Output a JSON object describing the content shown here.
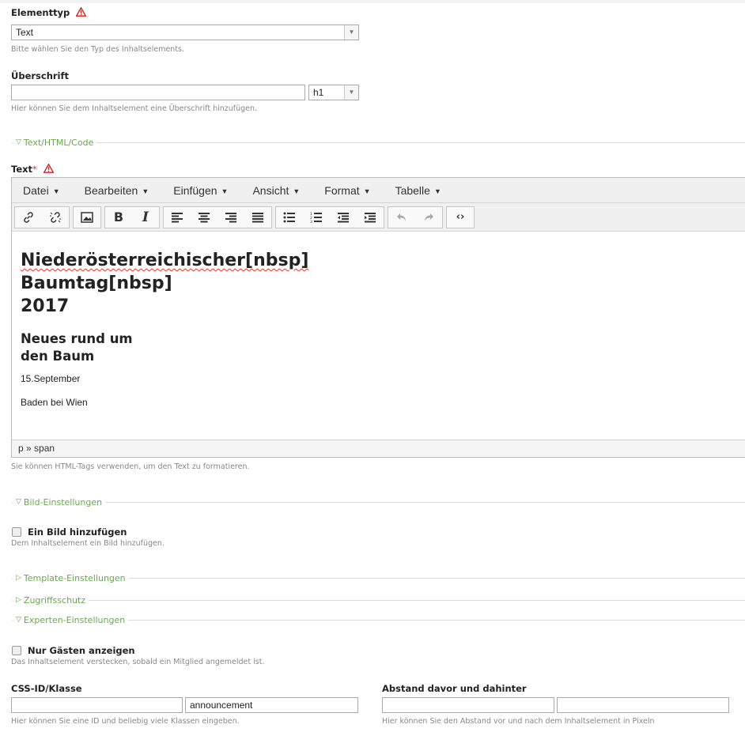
{
  "element_type": {
    "label": "Elementtyp",
    "value": "Text",
    "help": "Bitte wählen Sie den Typ des Inhaltselements."
  },
  "headline": {
    "label": "Überschrift",
    "value": "",
    "level": "h1",
    "help": "Hier können Sie dem Inhaltselement eine Überschrift hinzufügen."
  },
  "sections": {
    "text_html": "Text/HTML/Code",
    "image": "Bild-Einstellungen",
    "template": "Template-Einstellungen",
    "access": "Zugriffsschutz",
    "expert": "Experten-Einstellungen"
  },
  "text_field": {
    "label": "Text",
    "required_mark": "*",
    "help": "Sie können HTML-Tags verwenden, um den Text zu formatieren."
  },
  "editor": {
    "menu": [
      "Datei",
      "Bearbeiten",
      "Einfügen",
      "Ansicht",
      "Format",
      "Tabelle"
    ],
    "content": {
      "h1_line1": "Niederösterreichischer[nbsp]",
      "h1_line2": "Baumtag[nbsp]",
      "h1_line3": "2017",
      "h2_line1": "Neues rund um",
      "h2_line2": "den Baum",
      "p1": "15.September",
      "p2": "Baden bei Wien"
    },
    "status_path": "p » span"
  },
  "add_image": {
    "label": "Ein Bild hinzufügen",
    "help": "Dem Inhaltselement ein Bild hinzufügen.",
    "checked": false
  },
  "guests_only": {
    "label": "Nur Gästen anzeigen",
    "help": "Das Inhaltselement verstecken, sobald ein Mitglied angemeldet ist.",
    "checked": false
  },
  "css_id": {
    "label": "CSS-ID/Klasse",
    "id_value": "",
    "class_value": "announcement",
    "help": "Hier können Sie eine ID und beliebig viele Klassen eingeben."
  },
  "spacing": {
    "label": "Abstand davor und dahinter",
    "before": "",
    "after": "",
    "help": "Hier können Sie den Abstand vor und nach dem Inhaltselement in Pixeln"
  },
  "colors": {
    "legend": "#6aa84f",
    "warning": "#cc2222",
    "spellcheck": "#ee3333"
  }
}
